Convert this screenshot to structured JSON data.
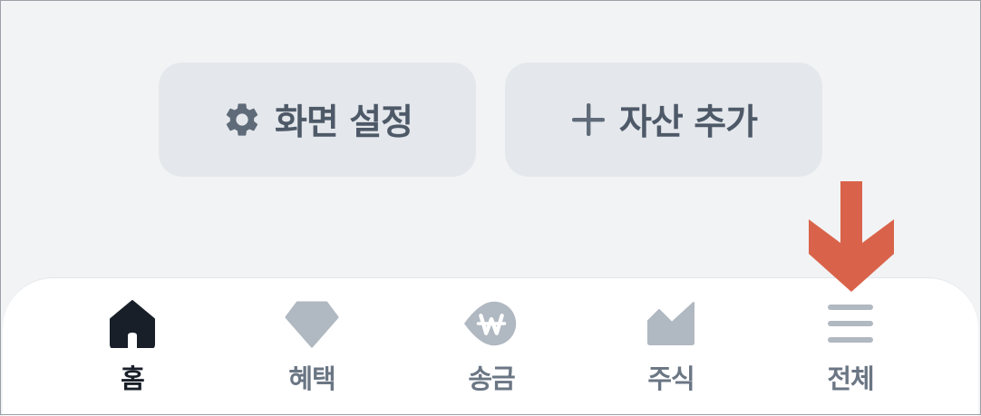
{
  "actions": {
    "settings_label": "화면 설정",
    "add_asset_label": "자산 추가"
  },
  "tabbar": {
    "items": [
      {
        "label": "홈",
        "icon": "home-icon",
        "active": true
      },
      {
        "label": "혜택",
        "icon": "diamond-icon",
        "active": false
      },
      {
        "label": "송금",
        "icon": "won-icon",
        "active": false
      },
      {
        "label": "주식",
        "icon": "chart-icon",
        "active": false
      },
      {
        "label": "전체",
        "icon": "menu-icon",
        "active": false
      }
    ]
  },
  "colors": {
    "background": "#f2f3f5",
    "button_bg": "#e4e8ec",
    "text": "#4e5968",
    "active_icon": "#191f28",
    "inactive_icon": "#b0b8c1",
    "arrow": "#d9634a"
  }
}
